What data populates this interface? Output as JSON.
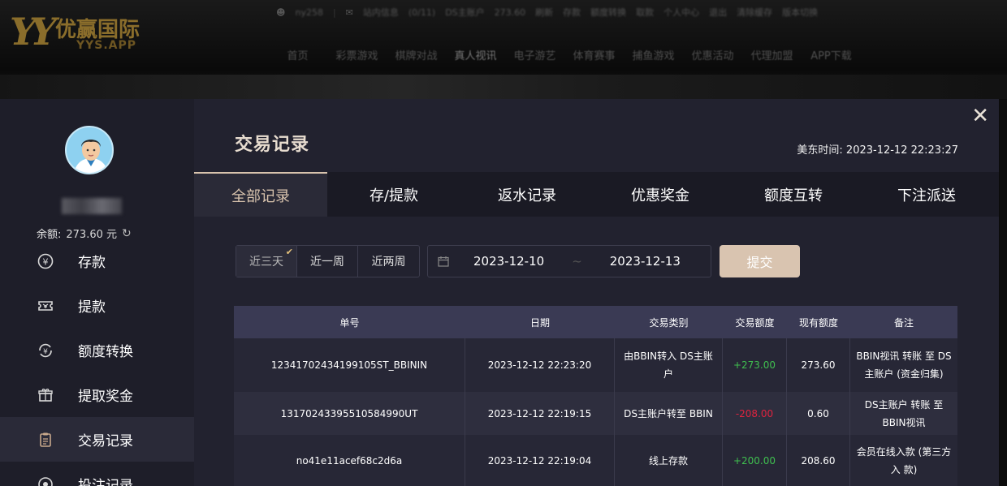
{
  "header": {
    "logo": {
      "name": "优赢国际",
      "sub": "YYS.APP"
    },
    "topbar": [
      "ny258",
      "站内信息",
      "(0/11)",
      "DS主账户",
      "273.60",
      "刷新",
      "存款",
      "额度转换",
      "取款",
      "个人中心",
      "退出",
      "清除缓存",
      "版本切换"
    ],
    "nav": [
      "首页",
      "彩票游戏",
      "棋牌对战",
      "真人视讯",
      "电子游艺",
      "体育赛事",
      "捕鱼游戏",
      "优惠活动",
      "代理加盟",
      "APP下载"
    ],
    "nav_active_index": 3
  },
  "sidebar": {
    "balance_label": "余额:",
    "balance_value": "273.60 元",
    "menu": [
      {
        "label": "存款",
        "icon": "yuan-circle-icon"
      },
      {
        "label": "提款",
        "icon": "ticket-icon"
      },
      {
        "label": "额度转换",
        "icon": "transfer-yuan-icon"
      },
      {
        "label": "提取奖金",
        "icon": "gift-icon"
      },
      {
        "label": "交易记录",
        "icon": "clipboard-icon",
        "active": true
      },
      {
        "label": "投注记录",
        "icon": "bet-icon"
      }
    ]
  },
  "content": {
    "title": "交易记录",
    "east_time_label": "美东时间:",
    "east_time_value": "2023-12-12 22:23:27",
    "close_symbol": "✕",
    "tabs": [
      "全部记录",
      "存/提款",
      "返水记录",
      "优惠奖金",
      "额度互转",
      "下注派送"
    ],
    "active_tab": 0,
    "quick_ranges": [
      "近三天",
      "近一周",
      "近两周"
    ],
    "active_range": 0,
    "date_start": "2023-12-10",
    "date_separator": "~",
    "date_end": "2023-12-13",
    "submit_label": "提交"
  },
  "table": {
    "headers": [
      "单号",
      "日期",
      "交易类别",
      "交易额度",
      "现有额度",
      "备注"
    ],
    "rows": [
      {
        "order_no": "12341702434199105ST_BBININ",
        "date": "2023-12-12 22:23:20",
        "type": "由BBIN转入 DS主账户",
        "amount": "+273.00",
        "balance": "273.60",
        "note": "BBIN视讯 转账 至 DS主账户 (资金归集)"
      },
      {
        "order_no": "13170243395510584990UT",
        "date": "2023-12-12 22:19:15",
        "type": "DS主账户转至 BBIN",
        "amount": "-208.00",
        "balance": "0.60",
        "note": "DS主账户 转账 至 BBIN视讯"
      },
      {
        "order_no": "no41e11acef68c2d6a",
        "date": "2023-12-12 22:19:04",
        "type": "线上存款",
        "amount": "+200.00",
        "balance": "208.60",
        "note": "会员在线入款 (第三方入 款)"
      }
    ]
  },
  "colors": {
    "accent": "#d8c3ad",
    "positive": "#3fbf4f",
    "negative": "#e0233e",
    "header_bg": "#3a3a54"
  }
}
